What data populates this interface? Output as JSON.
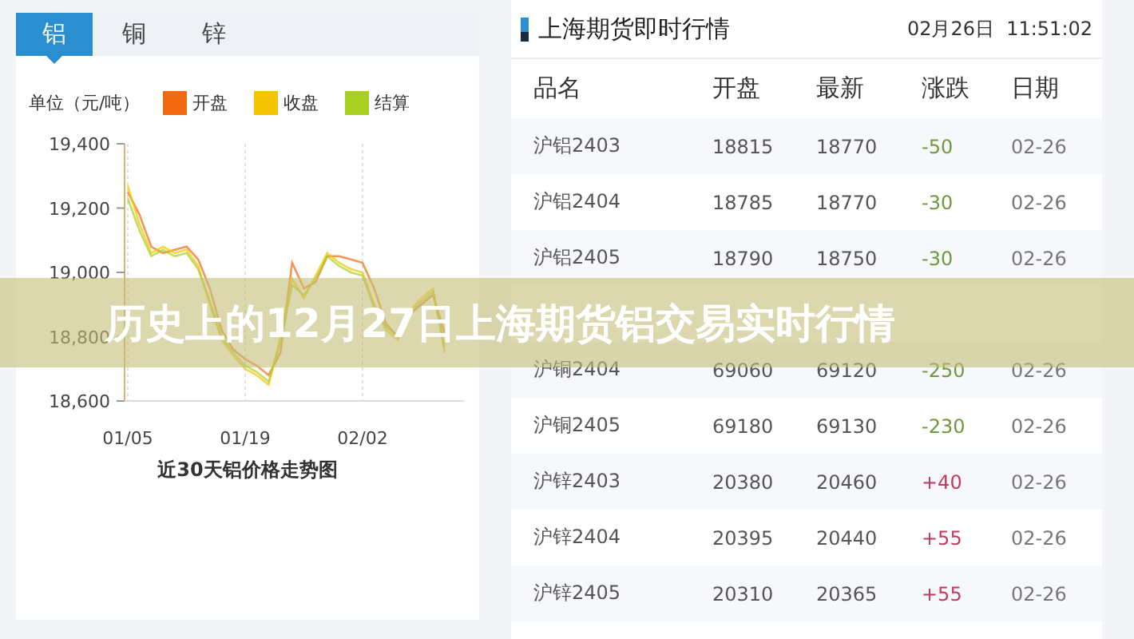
{
  "metal_tabs": [
    {
      "label": "铝",
      "selected": true
    },
    {
      "label": "铜",
      "selected": false
    },
    {
      "label": "锌",
      "selected": false
    }
  ],
  "price_chart": {
    "unit": "单位（元/吨）",
    "caption": "近30天铝价格走势图",
    "chart_data": {
      "type": "line",
      "categories": [
        "01/05",
        null,
        null,
        null,
        null,
        null,
        null,
        null,
        null,
        null,
        "01/19",
        null,
        null,
        null,
        null,
        null,
        null,
        null,
        null,
        null,
        "02/02",
        null,
        null,
        null,
        null,
        null,
        null,
        null
      ],
      "series": [
        {
          "name": "开盘",
          "color": "#f26a10",
          "values": [
            19250,
            19180,
            19080,
            19060,
            19070,
            19080,
            19040,
            18950,
            18820,
            18760,
            18730,
            18710,
            18680,
            18750,
            19030,
            18950,
            18970,
            19050,
            19050,
            19040,
            19030,
            18950,
            18840,
            18800,
            18870,
            18900,
            18930,
            18810
          ]
        },
        {
          "name": "收盘",
          "color": "#f5c400",
          "values": [
            19270,
            19150,
            19060,
            19080,
            19060,
            19070,
            19020,
            18900,
            18790,
            18740,
            18700,
            18680,
            18650,
            18800,
            18980,
            18920,
            18990,
            19060,
            19030,
            19010,
            19000,
            18900,
            18820,
            18790,
            18880,
            18920,
            18950,
            18750
          ]
        },
        {
          "name": "结算",
          "color": "#a8d020",
          "values": [
            19230,
            19130,
            19050,
            19070,
            19050,
            19060,
            19010,
            18910,
            18800,
            18750,
            18710,
            18690,
            18660,
            18780,
            18960,
            18930,
            18980,
            19050,
            19020,
            19000,
            18990,
            18890,
            18830,
            18800,
            18870,
            18910,
            18940,
            18770
          ]
        }
      ],
      "ylim": [
        18600,
        19400
      ],
      "yticks": [
        {
          "value": 18600,
          "label": "18,600"
        },
        {
          "value": 18800,
          "label": "18,800"
        },
        {
          "value": 19000,
          "label": "19,000"
        },
        {
          "value": 19200,
          "label": "19,200"
        },
        {
          "value": 19400,
          "label": "19,400"
        }
      ]
    }
  },
  "quotes": {
    "title": "上海期货即时行情",
    "timestamp": "02月26日  11:51:02",
    "columns": [
      "品名",
      "开盘",
      "最新",
      "涨跌",
      "日期"
    ],
    "rows_above_banner": [
      {
        "name": "沪铝2403",
        "open": "18815",
        "latest": "18770",
        "change": "-50",
        "color": "#6e9a3c",
        "date": "02-26"
      },
      {
        "name": "沪铝2404",
        "open": "18785",
        "latest": "18770",
        "change": "-30",
        "color": "#6e9a3c",
        "date": "02-26"
      },
      {
        "name": "沪铝2405",
        "open": "18790",
        "latest": "18750",
        "change": "-30",
        "color": "#6e9a3c",
        "date": "02-26"
      }
    ],
    "rows_below_banner": [
      {
        "name": "沪铜2404",
        "open": "69060",
        "latest": "69120",
        "change": "-250",
        "color": "#6e9a3c",
        "date": "02-26"
      },
      {
        "name": "沪铜2405",
        "open": "69180",
        "latest": "69130",
        "change": "-230",
        "color": "#6e9a3c",
        "date": "02-26"
      },
      {
        "name": "沪锌2403",
        "open": "20380",
        "latest": "20460",
        "change": "+40",
        "color": "#c43a5c",
        "date": "02-26"
      },
      {
        "name": "沪锌2404",
        "open": "20395",
        "latest": "20440",
        "change": "+55",
        "color": "#c43a5c",
        "date": "02-26"
      },
      {
        "name": "沪锌2405",
        "open": "20310",
        "latest": "20365",
        "change": "+55",
        "color": "#c43a5c",
        "date": "02-26"
      }
    ]
  },
  "overlay_banner": {
    "title": "历史上的12月27日上海期货铝交易实时行情"
  }
}
